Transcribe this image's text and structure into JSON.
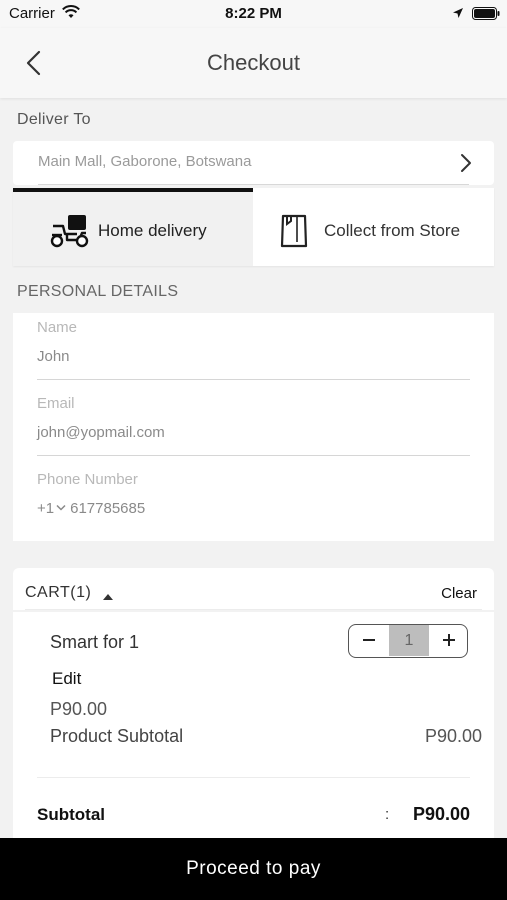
{
  "status_bar": {
    "carrier": "Carrier",
    "time": "8:22 PM"
  },
  "nav": {
    "title": "Checkout"
  },
  "deliver_to": {
    "label": "Deliver To",
    "address": "Main Mall, Gaborone, Botswana"
  },
  "delivery_options": [
    {
      "label": "Home delivery",
      "selected": true
    },
    {
      "label": "Collect from Store",
      "selected": false
    }
  ],
  "personal_details": {
    "heading": "PERSONAL DETAILS",
    "name_label": "Name",
    "name_value": "John",
    "email_label": "Email",
    "email_value": "john@yopmail.com",
    "phone_label": "Phone Number",
    "phone_code": "+1",
    "phone_value": "617785685"
  },
  "cart": {
    "title": "CART(1)",
    "clear_label": "Clear",
    "item": {
      "name": "Smart for 1",
      "quantity": "1",
      "edit_label": "Edit",
      "price": "P90.00",
      "product_subtotal_label": "Product Subtotal",
      "product_subtotal_value": "P90.00"
    },
    "subtotal_label": "Subtotal",
    "subtotal_separator": ":",
    "subtotal_value": "P90.00"
  },
  "footer": {
    "pay_label": "Proceed to pay"
  }
}
